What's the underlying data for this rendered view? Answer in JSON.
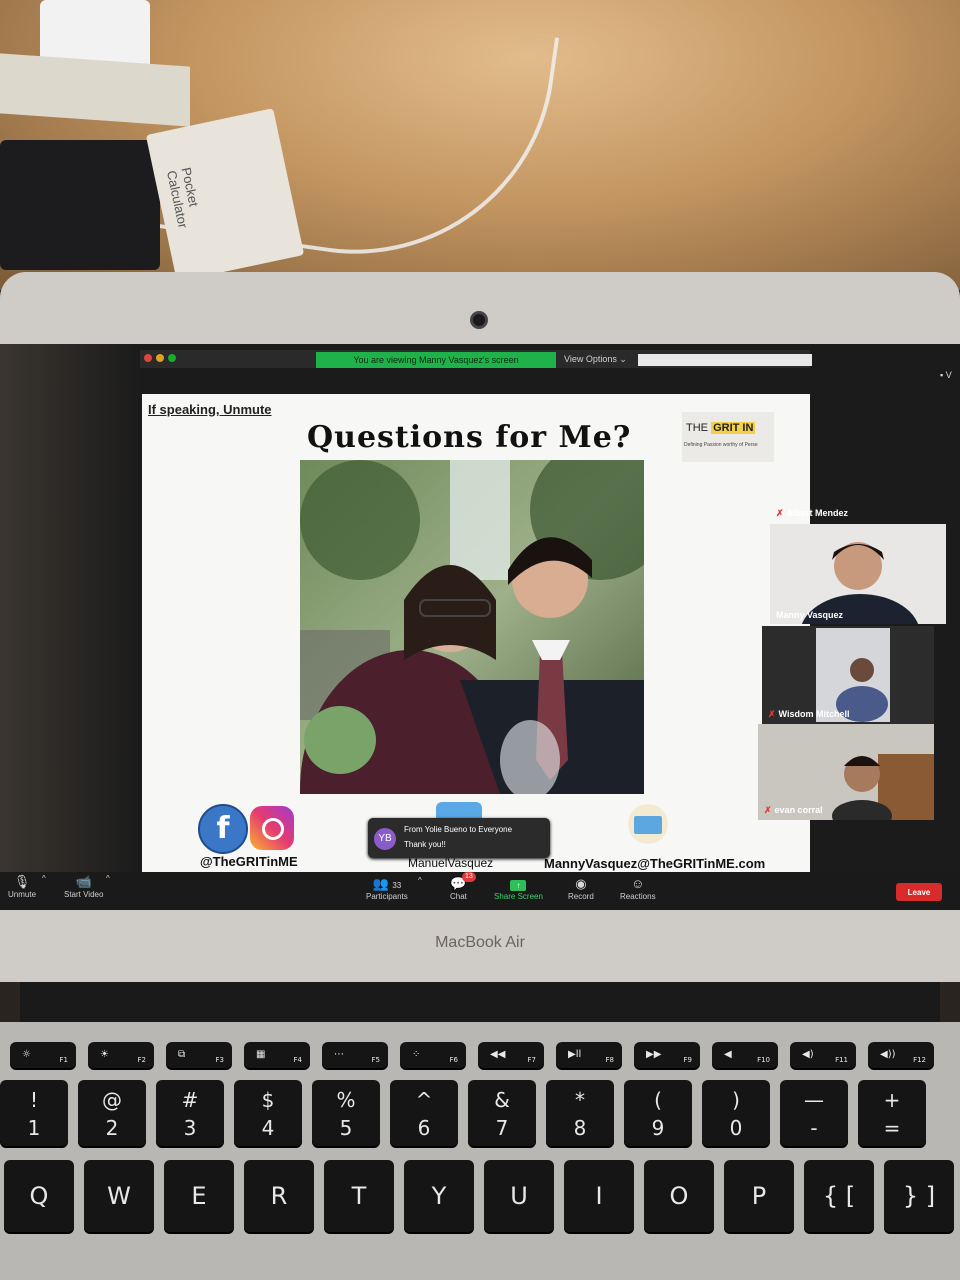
{
  "device": {
    "brand": "MacBook Air"
  },
  "zoom": {
    "viewing_banner": "You are viewing Manny Vasquez's screen",
    "view_options": "View Options ⌄",
    "top_right_label": "▪ V"
  },
  "slide": {
    "unmute_note": "If speaking, Unmute",
    "title": "Questions for Me?",
    "logo_main_pre": "THE ",
    "logo_main_hl": "GRIT IN",
    "logo_sub": "Defining Passion worthy of Perse",
    "social_handle": "@TheGRITinME",
    "name": "ManuelVasquez",
    "email": "MannyVasquez@TheGRITinME.com",
    "fb_glyph": "f"
  },
  "chat_toast": {
    "avatar_initials": "YB",
    "from": "From Yolie Bueno to Everyone",
    "message": "Thank you!!"
  },
  "participants": [
    {
      "name": "Albert Mendez",
      "muted": true
    },
    {
      "name": "Manny Vasquez",
      "muted": false
    },
    {
      "name": "Wisdom Mitchell",
      "muted": true
    },
    {
      "name": "evan corral",
      "muted": true
    }
  ],
  "toolbar": {
    "unmute": "Unmute",
    "start_video": "Start Video",
    "participants": "Participants",
    "participant_count": "33",
    "chat": "Chat",
    "chat_badge": "13",
    "share_screen": "Share Screen",
    "record": "Record",
    "reactions": "Reactions",
    "leave": "Leave",
    "caret": "^"
  },
  "keyboard": {
    "fkeys": [
      {
        "icon": "☼",
        "label": "F1"
      },
      {
        "icon": "☀",
        "label": "F2"
      },
      {
        "icon": "⧉",
        "label": "F3"
      },
      {
        "icon": "▦",
        "label": "F4"
      },
      {
        "icon": "⋯",
        "label": "F5"
      },
      {
        "icon": "⁘",
        "label": "F6"
      },
      {
        "icon": "◀◀",
        "label": "F7"
      },
      {
        "icon": "▶ll",
        "label": "F8"
      },
      {
        "icon": "▶▶",
        "label": "F9"
      },
      {
        "icon": "◀",
        "label": "F10"
      },
      {
        "icon": "◀)",
        "label": "F11"
      },
      {
        "icon": "◀))",
        "label": "F12"
      }
    ],
    "numrow": [
      {
        "top": "!",
        "bot": "1"
      },
      {
        "top": "@",
        "bot": "2"
      },
      {
        "top": "#",
        "bot": "3"
      },
      {
        "top": "$",
        "bot": "4"
      },
      {
        "top": "%",
        "bot": "5"
      },
      {
        "top": "^",
        "bot": "6"
      },
      {
        "top": "&",
        "bot": "7"
      },
      {
        "top": "*",
        "bot": "8"
      },
      {
        "top": "(",
        "bot": "9"
      },
      {
        "top": ")",
        "bot": "0"
      },
      {
        "top": "—",
        "bot": "-"
      },
      {
        "top": "+",
        "bot": "="
      }
    ],
    "letters": [
      "Q",
      "W",
      "E",
      "R",
      "T",
      "Y",
      "U",
      "I",
      "O",
      "P",
      "{ [",
      "} ]"
    ]
  },
  "colors": {
    "share_green": "#1fb24a",
    "leave_red": "#d82b2b",
    "badge_red": "#e03a3a"
  }
}
